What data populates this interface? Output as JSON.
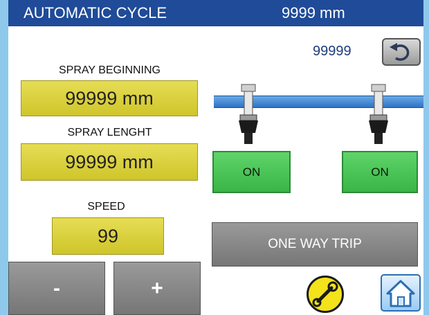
{
  "header": {
    "title": "AUTOMATIC CYCLE",
    "position": "9999 mm"
  },
  "counter": "99999",
  "spray_beginning": {
    "label": "SPRAY BEGINNING",
    "value": "99999 mm"
  },
  "spray_length": {
    "label": "SPRAY LENGHT",
    "value": "99999 mm"
  },
  "speed": {
    "label": "SPEED",
    "value": "99",
    "decrease_label": "-",
    "increase_label": "+"
  },
  "nozzles": [
    {
      "state_label": "ON"
    },
    {
      "state_label": "ON"
    }
  ],
  "one_way_trip_label": "ONE WAY TRIP",
  "icons": {
    "back": "undo-arrow-icon",
    "settings": "wrench-icon",
    "home": "home-icon"
  },
  "colors": {
    "header_bg": "#1f4b98",
    "value_box": "#d9cf36",
    "on_button": "#4cc257",
    "gray_button": "#888888",
    "frame": "#8ec9ec"
  }
}
